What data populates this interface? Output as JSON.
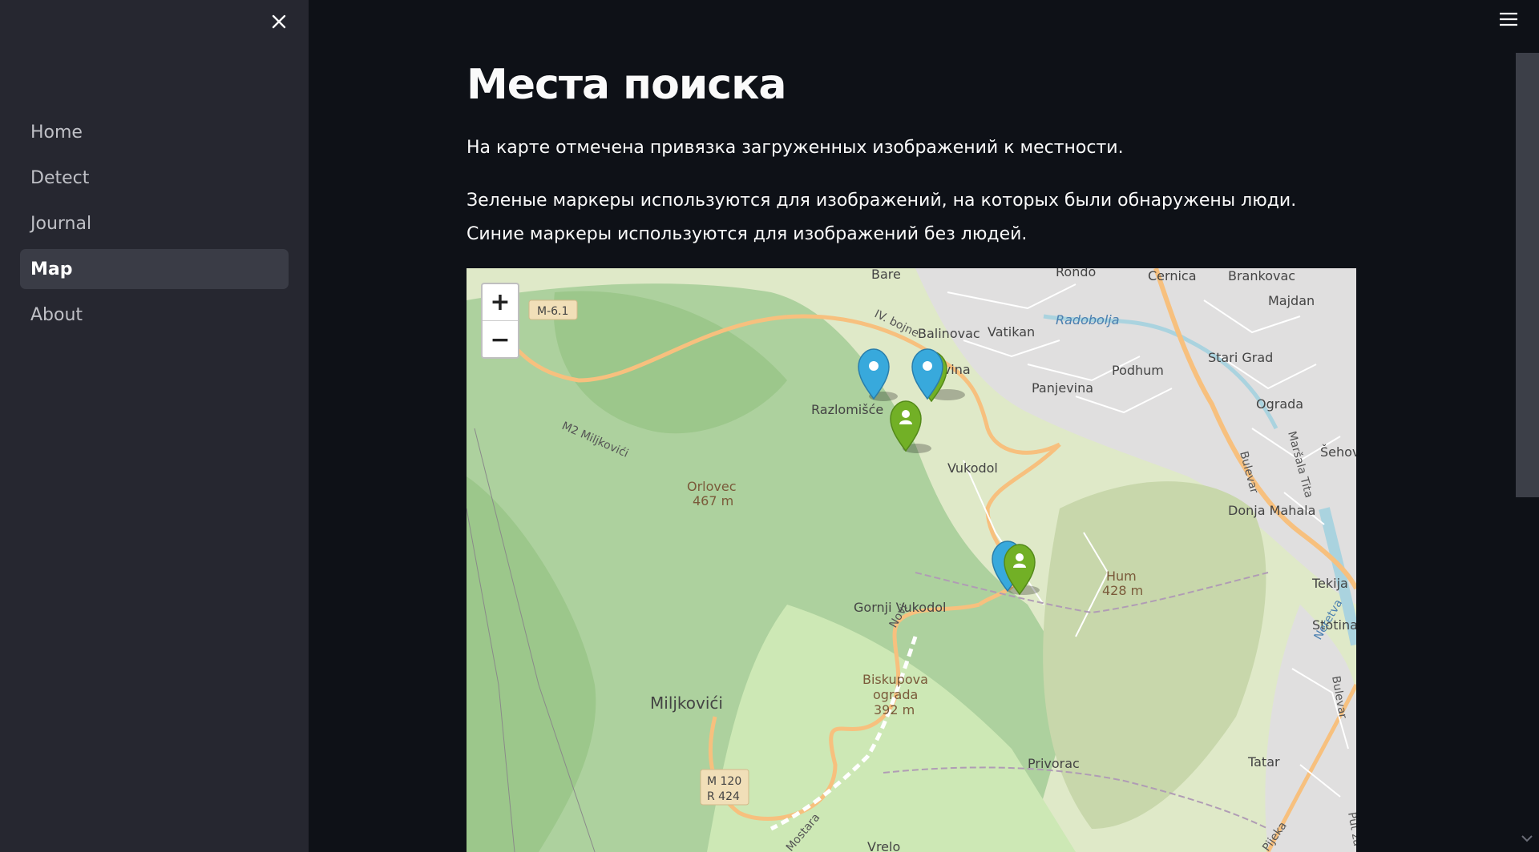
{
  "sidebar": {
    "close_label": "×",
    "items": [
      {
        "label": "Home",
        "active": false
      },
      {
        "label": "Detect",
        "active": false
      },
      {
        "label": "Journal",
        "active": false
      },
      {
        "label": "Map",
        "active": true
      },
      {
        "label": "About",
        "active": false
      }
    ]
  },
  "main": {
    "title": "Места поиска",
    "paragraph1": "На карте отмечена привязка загруженных изображений к местности.",
    "paragraph2": "Зеленые маркеры используются для изображений, на которых были обнаружены люди. Синие маркеры используются для изображений без людей."
  },
  "map": {
    "zoom_in": "+",
    "zoom_out": "−",
    "road_labels": [
      "M-6.1",
      "M 120",
      "R 424"
    ],
    "place_labels": [
      "Bare",
      "Rondo",
      "Cernica",
      "Brankovac",
      "Majdan",
      "Balinovac",
      "Vatikan",
      "Radobolja",
      "Stari Grad",
      "Podhum",
      "Panjevina",
      "Ograda",
      "Šehov",
      "ovina",
      "Razlomišće",
      "Vukodol",
      "Orlovec",
      "467 m",
      "Bulevar",
      "Maršala Tita",
      "Donja Mahala",
      "Hum",
      "428 m",
      "Tekija",
      "Neretva",
      "Stotina",
      "Gornji Vukodol",
      "Novi",
      "Biskupova",
      "ograda",
      "392 m",
      "Miljkovići",
      "M2 Miljkovići",
      "IV. bojne",
      "Privorac",
      "Tatar",
      "Put za",
      "Mostara",
      "Vrelo",
      "Bulevar",
      "Pijeka"
    ],
    "marker_colors": {
      "people": "#72b026",
      "no_people": "#38a9dc"
    },
    "markers": [
      {
        "type": "no_people",
        "icon": "circle-icon"
      },
      {
        "type": "people",
        "icon": "person-icon"
      },
      {
        "type": "no_people",
        "icon": "circle-icon"
      },
      {
        "type": "people",
        "icon": "person-icon"
      },
      {
        "type": "no_people",
        "icon": "circle-icon"
      },
      {
        "type": "people",
        "icon": "person-icon"
      }
    ]
  }
}
